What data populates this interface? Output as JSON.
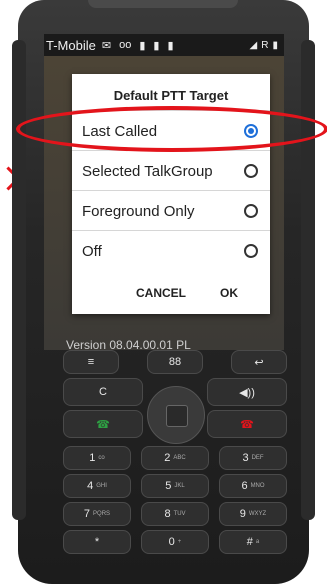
{
  "status_bar": {
    "carrier": "T-Mobile",
    "icons": [
      "message-icon",
      "voicemail-icon",
      "ptt-icon",
      "ptt-icon",
      "ptt-icon"
    ],
    "right_icons": [
      "signal-icon",
      "R",
      "battery-icon"
    ]
  },
  "dialog": {
    "title": "Default PTT Target",
    "options": [
      {
        "label": "Last Called",
        "selected": true
      },
      {
        "label": "Selected TalkGroup",
        "selected": false
      },
      {
        "label": "Foreground Only",
        "selected": false
      },
      {
        "label": "Off",
        "selected": false
      }
    ],
    "cancel_label": "CANCEL",
    "ok_label": "OK"
  },
  "background_app": {
    "version_text": "Version 08.04.00.01 PL"
  },
  "keypad": {
    "keys": [
      {
        "main": "≡",
        "sub": ""
      },
      {
        "main": "88",
        "sub": ""
      },
      {
        "main": "↩",
        "sub": ""
      },
      {
        "main": "C",
        "sub": ""
      },
      {
        "main": "◀))",
        "sub": ""
      },
      {
        "main": "1",
        "sub": "co"
      },
      {
        "main": "2",
        "sub": "ABC"
      },
      {
        "main": "3",
        "sub": "DEF"
      },
      {
        "main": "4",
        "sub": "GHI"
      },
      {
        "main": "5",
        "sub": "JKL"
      },
      {
        "main": "6",
        "sub": "MNO"
      },
      {
        "main": "7",
        "sub": "PQRS"
      },
      {
        "main": "8",
        "sub": "TUV"
      },
      {
        "main": "9",
        "sub": "WXYZ"
      },
      {
        "main": "*",
        "sub": ""
      },
      {
        "main": "0",
        "sub": "+"
      },
      {
        "main": "#",
        "sub": "a"
      }
    ]
  },
  "colors": {
    "highlight": "#e3141b",
    "radio_selected": "#1e6fd9"
  }
}
